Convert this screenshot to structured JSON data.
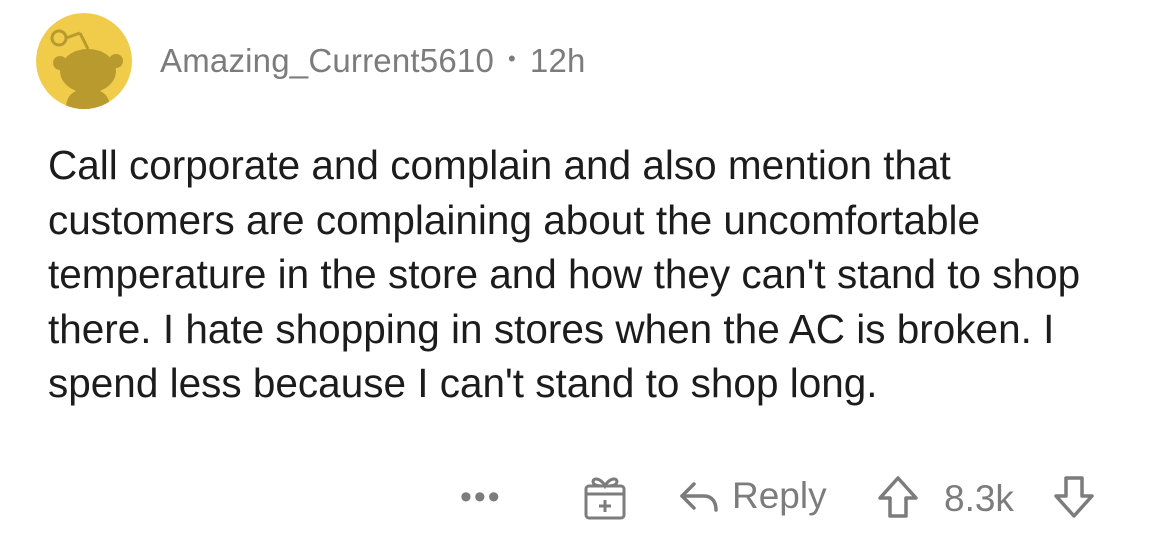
{
  "comment": {
    "author": "Amazing_Current5610",
    "separator": "•",
    "age": "12h",
    "text": "Call corporate and complain and also mention that customers are complaining about the uncomfortable temperature in the store and how they can't stand to shop there. I hate shopping in stores when the AC is broken. I spend less because I can't stand to shop long.",
    "avatar_color": "#f0cc4a",
    "avatar_figure_color": "#b89a2e"
  },
  "actions": {
    "more_label": "•••",
    "award_icon": "gift-icon",
    "reply_icon": "reply-arrow-icon",
    "reply_label": "Reply",
    "upvote_icon": "upvote-arrow-icon",
    "score": "8.3k",
    "downvote_icon": "downvote-arrow-icon"
  }
}
